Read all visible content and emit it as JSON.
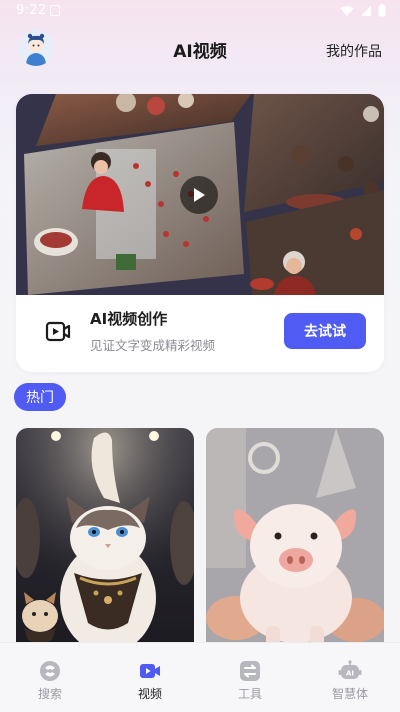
{
  "status_bar": {
    "time": "9:22"
  },
  "header": {
    "title": "AI视频",
    "my_works": "我的作品"
  },
  "hero": {
    "title": "AI视频创作",
    "subtitle": "见证文字变成精彩视频",
    "try_button": "去试试"
  },
  "hot_tag": "热门",
  "bottom_nav": {
    "items": [
      {
        "label": "搜索",
        "icon": "search-icon",
        "active": false
      },
      {
        "label": "视频",
        "icon": "video-icon",
        "active": true
      },
      {
        "label": "工具",
        "icon": "tools-icon",
        "active": false
      },
      {
        "label": "智慧体",
        "icon": "ai-agent-icon",
        "active": false
      }
    ]
  },
  "colors": {
    "accent": "#4f5bf2",
    "nav_inactive": "#9a9aa3",
    "background": "#f5f5f8"
  }
}
